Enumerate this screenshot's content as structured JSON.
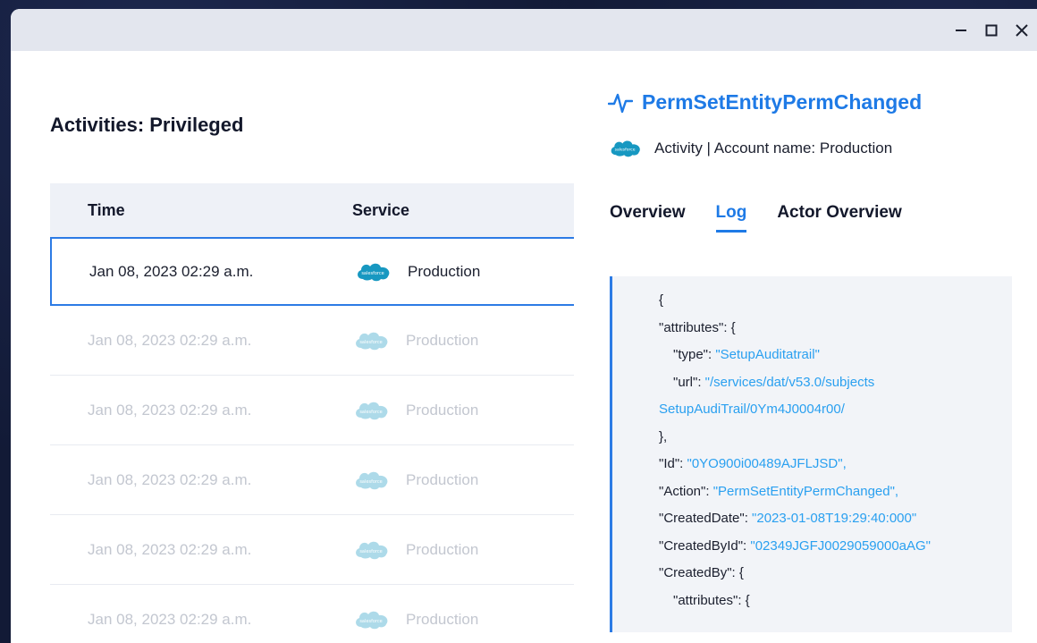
{
  "window": {
    "controls": {
      "minimize": "−",
      "maximize": "□",
      "close": "✕"
    }
  },
  "list": {
    "title": "Activities: Privileged",
    "columns": [
      "Time",
      "Service"
    ],
    "rows": [
      {
        "time": "Jan 08, 2023 02:29 a.m.",
        "service": "Production",
        "selected": true
      },
      {
        "time": "Jan 08, 2023 02:29 a.m.",
        "service": "Production",
        "selected": false
      },
      {
        "time": "Jan 08, 2023 02:29 a.m.",
        "service": "Production",
        "selected": false
      },
      {
        "time": "Jan 08, 2023 02:29 a.m.",
        "service": "Production",
        "selected": false
      },
      {
        "time": "Jan 08, 2023 02:29 a.m.",
        "service": "Production",
        "selected": false
      },
      {
        "time": "Jan 08, 2023 02:29 a.m.",
        "service": "Production",
        "selected": false
      }
    ]
  },
  "detail": {
    "title": "PermSetEntityPermChanged",
    "title_icon": "activity-pulse-icon",
    "subtitle": "Activity | Account name: Production",
    "service_icon": "salesforce-logo",
    "tabs": [
      "Overview",
      "Log",
      "Actor Overview"
    ],
    "active_tab": "Log",
    "log_lines": [
      {
        "key": "{",
        "value": ""
      },
      {
        "key": "\"attributes\": {",
        "value": ""
      },
      {
        "key": "\"type\": ",
        "value": "\"SetupAuditatrail\""
      },
      {
        "key": "\"url\": ",
        "value": "\"/services/dat/v53.0/subjects"
      },
      {
        "key": "",
        "value": "SetupAudiTrail/0Ym4J0004r00/"
      },
      {
        "key": "},",
        "value": ""
      },
      {
        "key": "\"Id\": ",
        "value": "\"0YO900i00489AJFLJSD\","
      },
      {
        "key": "\"Action\": ",
        "value": "\"PermSetEntityPermChanged\","
      },
      {
        "key": "\"CreatedDate\": ",
        "value": "\"2023-01-08T19:29:40:000\""
      },
      {
        "key": "\"CreatedById\": ",
        "value": "\"02349JGFJ0029059000aAG\""
      },
      {
        "key": "\"CreatedBy\": {",
        "value": ""
      },
      {
        "key": "\"attributes\": {",
        "value": ""
      }
    ]
  },
  "colors": {
    "accent": "#1e7ae6",
    "salesforce": "#1798c1",
    "json_string": "#2aa0f0"
  }
}
